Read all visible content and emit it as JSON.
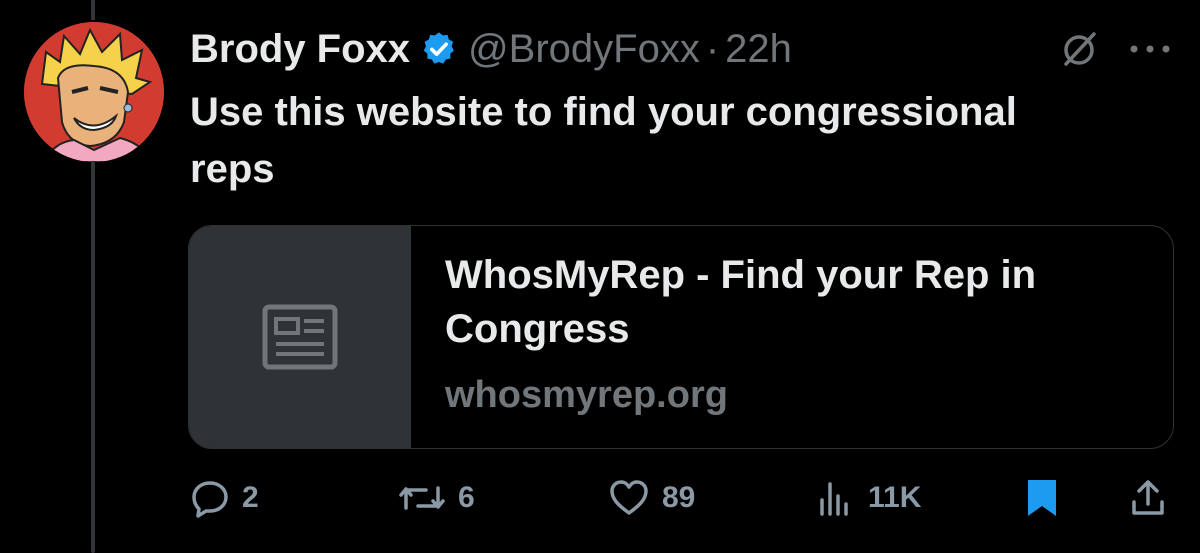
{
  "author": {
    "name": "Brody Foxx",
    "handle": "@BrodyFoxx",
    "separator": "·",
    "time": "22h"
  },
  "tweet": {
    "text": "Use this website to find your congressional reps"
  },
  "link_card": {
    "title": "WhosMyRep - Find your Rep in Congress",
    "domain": "whosmyrep.org"
  },
  "actions": {
    "replies": "2",
    "reposts": "6",
    "likes": "89",
    "views": "11K"
  },
  "icons": {
    "verified": "verified-badge-icon",
    "grok": "grok-icon",
    "more": "more-icon",
    "article": "article-icon",
    "reply": "reply-icon",
    "repost": "repost-icon",
    "like": "heart-icon",
    "views": "views-icon",
    "bookmark": "bookmark-icon",
    "share": "share-icon"
  },
  "colors": {
    "background": "#000000",
    "primary_text": "#e7e9ea",
    "secondary_text": "#71767b",
    "verified_blue": "#1d9bf0",
    "bookmark_blue": "#1d9bf0",
    "card_border": "#2f3336"
  }
}
